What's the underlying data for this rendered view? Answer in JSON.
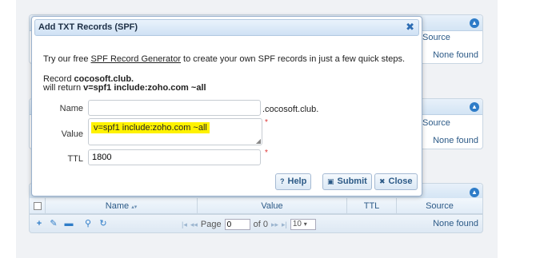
{
  "background_panels": [
    {
      "source_header": "Source",
      "none_found": "None found"
    },
    {
      "source_header": "Source",
      "none_found": "None found"
    }
  ],
  "bottom_grid": {
    "columns": [
      "Name",
      "Value",
      "TTL",
      "Source"
    ],
    "name_sort_indicator": "▴▾",
    "none_found": "None found",
    "pager": {
      "page_label": "Page",
      "page_value": "0",
      "of_label": "of 0",
      "page_size": "10"
    }
  },
  "dialog": {
    "title": "Add TXT Records (SPF)",
    "close_glyph": "✖",
    "intro_before": "Try our free ",
    "intro_link": "SPF Record Generator",
    "intro_after": " to create your own SPF records in just a few quick steps.",
    "record_prefix": "Record ",
    "record_name": "cocosoft.club.",
    "will_return_prefix": "will return ",
    "will_return_value": "v=spf1 include:zoho.com ~all",
    "fields": {
      "name_label": "Name",
      "name_value": "",
      "name_suffix": ".cocosoft.club.",
      "value_label": "Value",
      "value_value": "v=spf1 include:zoho.com ~all",
      "ttl_label": "TTL",
      "ttl_value": "1800",
      "required_mark": "*"
    },
    "buttons": {
      "help": "Help",
      "submit": "Submit",
      "close": "Close"
    }
  },
  "colors": {
    "accent": "#2e7cc8",
    "highlight": "#fff200",
    "required": "#d33333"
  },
  "icons": [
    "close-icon",
    "collapse-icon",
    "question-icon",
    "save-icon",
    "cancel-icon",
    "add-icon",
    "edit-icon",
    "delete-icon",
    "search-icon",
    "refresh-icon"
  ]
}
